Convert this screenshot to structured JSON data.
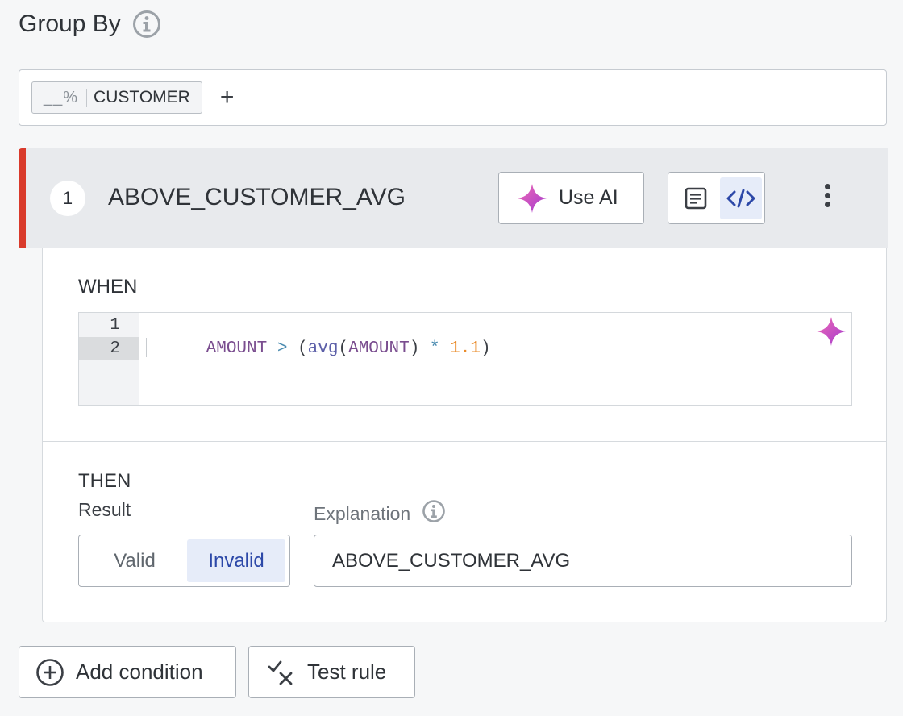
{
  "group_by": {
    "title": "Group By",
    "chips": [
      {
        "type_label": "__%",
        "label": "CUSTOMER"
      }
    ],
    "add_label": "+"
  },
  "rule": {
    "index": "1",
    "name": "ABOVE_CUSTOMER_AVG",
    "use_ai_label": "Use AI",
    "active_mode": "code",
    "accent_color": "#d93a2b"
  },
  "when": {
    "label": "WHEN",
    "line_numbers": [
      "1",
      "2"
    ],
    "code_tokens": [
      {
        "text": "AMOUNT",
        "kind": "ident"
      },
      {
        "text": " > ",
        "kind": "op"
      },
      {
        "text": "(",
        "kind": "punc"
      },
      {
        "text": "avg",
        "kind": "fn"
      },
      {
        "text": "(",
        "kind": "punc"
      },
      {
        "text": "AMOUNT",
        "kind": "ident"
      },
      {
        "text": ")",
        "kind": "punc"
      },
      {
        "text": " * ",
        "kind": "op"
      },
      {
        "text": "1.1",
        "kind": "num"
      },
      {
        "text": ")",
        "kind": "punc"
      }
    ]
  },
  "then": {
    "label": "THEN",
    "result_label": "Result",
    "result_options": [
      "Valid",
      "Invalid"
    ],
    "result_selected": "Invalid",
    "explanation_label": "Explanation",
    "explanation_value": "ABOVE_CUSTOMER_AVG"
  },
  "actions": {
    "add_condition": "Add condition",
    "test_rule": "Test rule"
  }
}
